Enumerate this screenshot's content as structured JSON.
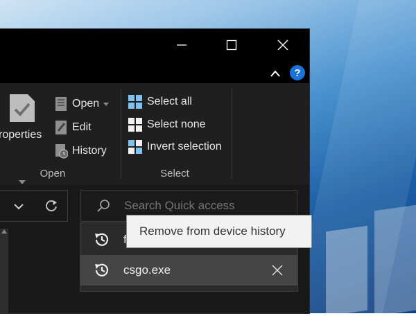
{
  "ribbon": {
    "properties_label": "roperties",
    "open_label": "Open",
    "edit_label": "Edit",
    "history_label": "History",
    "open_group_label": "Open",
    "select_all_label": "Select all",
    "select_none_label": "Select none",
    "invert_selection_label": "Invert selection",
    "select_group_label": "Select"
  },
  "search": {
    "placeholder": "Search Quick access"
  },
  "dropdown": {
    "items": [
      {
        "label": "f",
        "icon": "history-icon"
      },
      {
        "label": "csgo.exe",
        "icon": "history-icon"
      }
    ]
  },
  "tooltip": {
    "text": "Remove from device history"
  },
  "colors": {
    "accent_help": "#1a73d9",
    "window_bg": "#191919",
    "tooltip_bg": "#f2f2f2"
  }
}
